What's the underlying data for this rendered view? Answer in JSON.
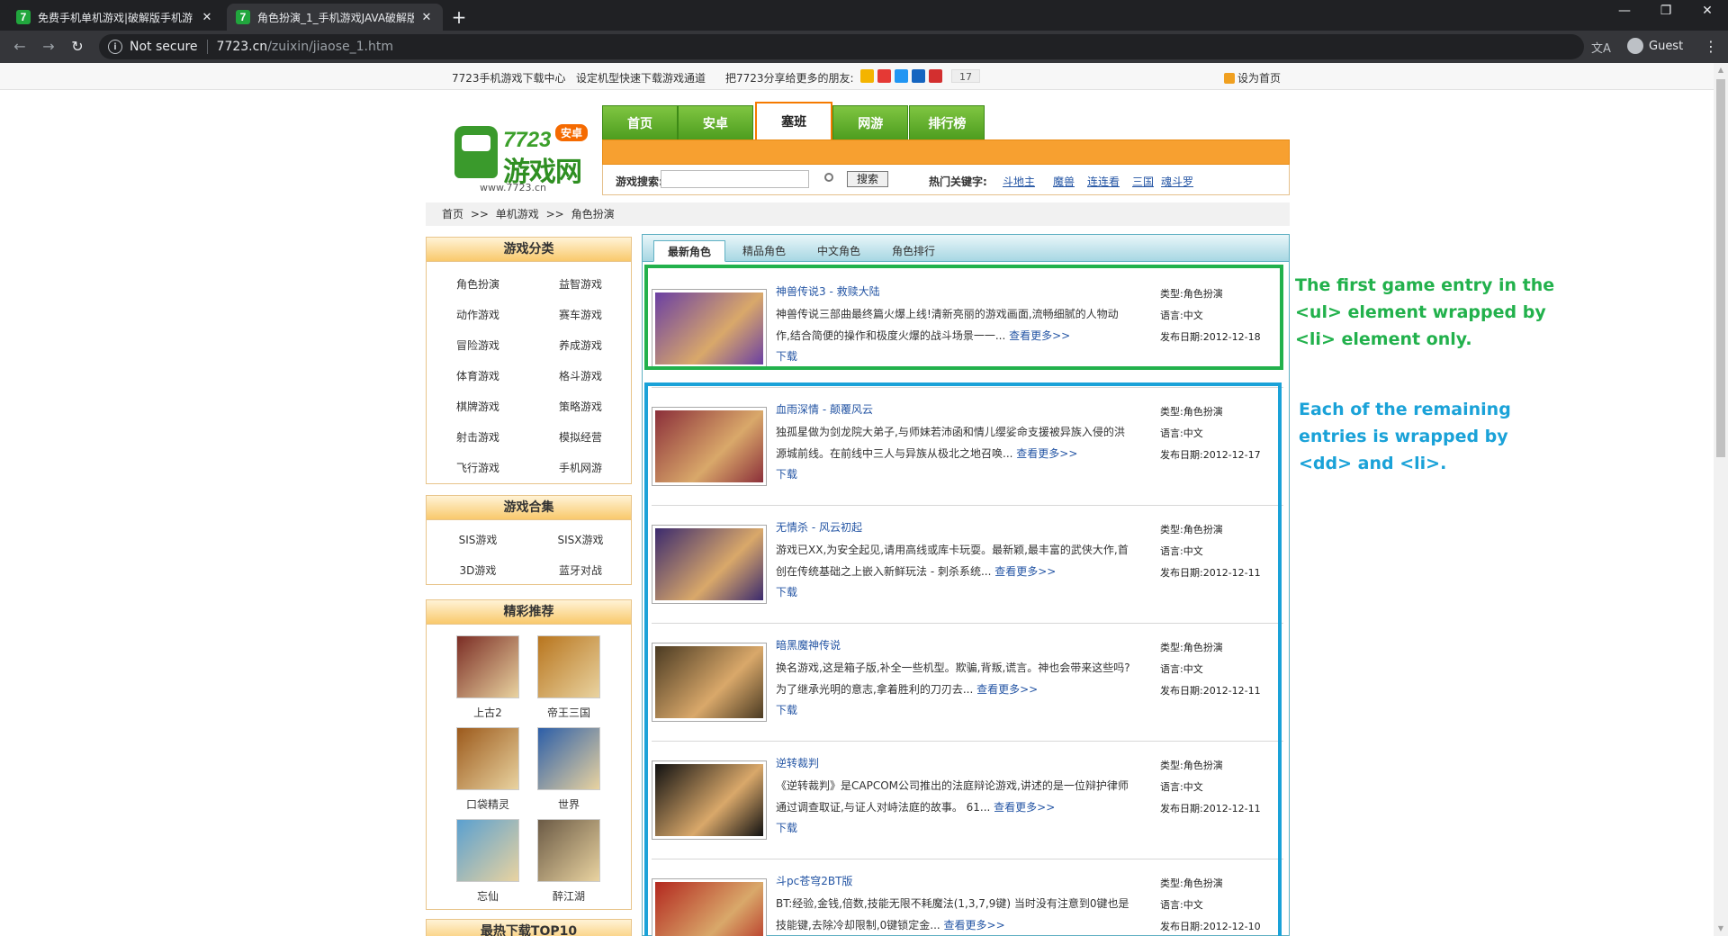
{
  "browser": {
    "tabs": [
      {
        "title": "免费手机单机游戏|破解版手机游",
        "active": false
      },
      {
        "title": "角色扮演_1_手机游戏JAVA破解版",
        "active": true
      }
    ],
    "favicon_text": "7",
    "close_glyph": "✕",
    "new_tab_glyph": "+",
    "window_controls": [
      "—",
      "❐",
      "✕"
    ],
    "security_label": "Not secure",
    "url_host": "7723.cn",
    "url_path": "/zuixin/jiaose_1.htm",
    "profile_label": "Guest"
  },
  "topstrip": {
    "links": [
      "7723手机游戏下载中心",
      "设定机型快速下载游戏通道"
    ],
    "share_label": "把7723分享给更多的朋友:",
    "share_icons": [
      "qzone-icon",
      "weibo-icon",
      "pengyou-icon",
      "renren-icon",
      "tqq-icon"
    ],
    "share_colors": [
      "#f4b400",
      "#e53935",
      "#2196f3",
      "#1565c0",
      "#d32f2f"
    ],
    "share_count": "17",
    "home_label": "设为首页"
  },
  "logo": {
    "number": "7723",
    "badge": "安卓",
    "cn": "游戏网",
    "url": "www.7723.cn"
  },
  "nav": {
    "tabs": [
      "首页",
      "安卓",
      "塞班",
      "网游",
      "排行榜"
    ],
    "active_index": 2,
    "search_label": "游戏搜索:",
    "search_placeholder": "",
    "search_button": "搜索",
    "hot_label": "热门关键字:",
    "keywords": [
      "斗地主",
      "魔兽",
      "连连看",
      "三国",
      "魂斗罗"
    ]
  },
  "breadcrumb": [
    "首页",
    "单机游戏",
    "角色扮演"
  ],
  "breadcrumb_sep": ">>",
  "sidebar": {
    "category_title": "游戏分类",
    "categories": [
      "角色扮演",
      "益智游戏",
      "动作游戏",
      "赛车游戏",
      "冒险游戏",
      "养成游戏",
      "体育游戏",
      "格斗游戏",
      "棋牌游戏",
      "策略游戏",
      "射击游戏",
      "模拟经营",
      "飞行游戏",
      "手机网游"
    ],
    "collection_title": "游戏合集",
    "collections": [
      "SIS游戏",
      "SISX游戏",
      "3D游戏",
      "蓝牙对战"
    ],
    "recommend_title": "精彩推荐",
    "recommends": [
      {
        "name": "上古2",
        "color": "#7b2d25"
      },
      {
        "name": "帝王三国",
        "color": "#b8751e"
      },
      {
        "name": "口袋精灵",
        "color": "#9c5a1c"
      },
      {
        "name": "世界",
        "color": "#2c5ea8"
      },
      {
        "name": "忘仙",
        "color": "#5aa0d0"
      },
      {
        "name": "醉江湖",
        "color": "#6b5a45"
      }
    ],
    "top10_title": "最热下载TOP10"
  },
  "list": {
    "tabs": [
      "最新角色",
      "精品角色",
      "中文角色",
      "角色排行"
    ],
    "active_tab": 0,
    "more_label": "查看更多>>",
    "download_label": "下载",
    "type_label": "类型:",
    "lang_label": "语言:",
    "date_label": "发布日期:",
    "entries": [
      {
        "name": "神兽传说3 - 救赎大陆",
        "desc": "神兽传说三部曲最终篇火爆上线!清新亮丽的游戏画面,流畅细腻的人物动作,结合简便的操作和极度火爆的战斗场景一一...",
        "type": "角色扮演",
        "lang": "中文",
        "date": "2012-12-18",
        "color": "#6a3fa3"
      },
      {
        "name": "血雨深情 - 颠覆风云",
        "desc": "独孤星做为剑龙院大弟子,与师妹若沛函和情儿缨娑命支援被异族入侵的洪源城前线。在前线中三人与异族从极北之地召唤...",
        "type": "角色扮演",
        "lang": "中文",
        "date": "2012-12-17",
        "color": "#8b2f3a"
      },
      {
        "name": "无情杀 - 风云初起",
        "desc": "游戏已XX,为安全起见,请用高线或库卡玩耍。最新颖,最丰富的武侠大作,首创在传统基础之上嵌入新鲜玩法 - 刺杀系统...",
        "type": "角色扮演",
        "lang": "中文",
        "date": "2012-12-11",
        "color": "#3b2a6e"
      },
      {
        "name": "暗黑魔神传说",
        "desc": "换名游戏,这是箱子版,补全一些机型。欺骗,背叛,谎言。神也会带来这些吗?为了继承光明的意志,拿着胜利的刀刃去...",
        "type": "角色扮演",
        "lang": "中文",
        "date": "2012-12-11",
        "color": "#4a3a22"
      },
      {
        "name": "逆转裁判",
        "desc": "《逆转裁判》是CAPCOM公司推出的法庭辩论游戏,讲述的是一位辩护律师通过调查取证,与证人对峙法庭的故事。 61...",
        "type": "角色扮演",
        "lang": "中文",
        "date": "2012-12-11",
        "color": "#111111"
      },
      {
        "name": "斗pc苍穹2BT版",
        "desc": "BT:经验,金钱,倍数,技能无限不耗魔法(1,3,7,9键) 当时没有注意到0键也是技能键,去除冷却限制,0键锁定金...",
        "type": "角色扮演",
        "lang": "中文",
        "date": "2012-12-10",
        "color": "#b3281f"
      }
    ]
  },
  "annotations": {
    "green": "The first game entry in the <ul> element wrapped by <li> element only.",
    "blue": "Each of the remaining entries is wrapped by <dd> and <li>."
  }
}
